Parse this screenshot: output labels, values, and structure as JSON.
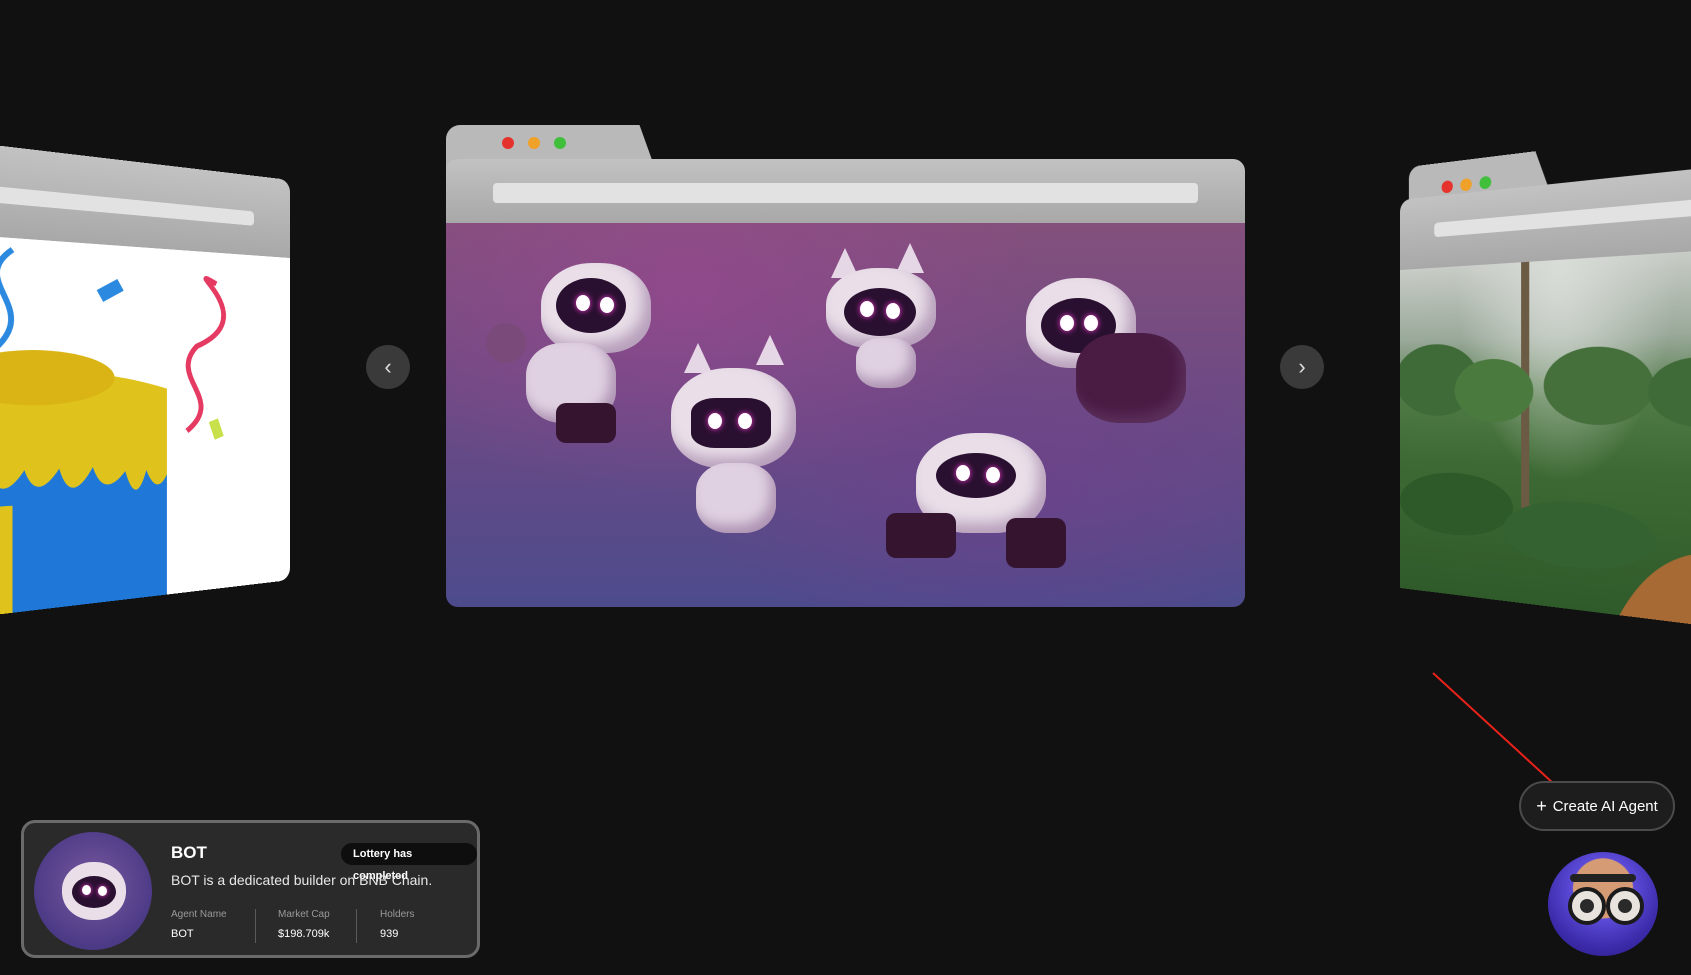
{
  "carousel": {
    "prev_icon": "‹",
    "next_icon": "›"
  },
  "create_button": {
    "icon": "+",
    "label": "Create AI Agent"
  },
  "agent_card": {
    "name": "BOT",
    "badge": "Lottery has completed",
    "description": "BOT is a dedicated builder on BNB Chain.",
    "stats": [
      {
        "label": "Agent Name",
        "value": "BOT"
      },
      {
        "label": "Market Cap",
        "value": "$198.709k"
      },
      {
        "label": "Holders",
        "value": "939"
      }
    ]
  },
  "colors": {
    "background": "#111111",
    "annotation_arrow": "#e8221a",
    "dot_red": "#e5322d",
    "dot_yellow": "#f0a12a",
    "dot_green": "#3fbf3a"
  }
}
